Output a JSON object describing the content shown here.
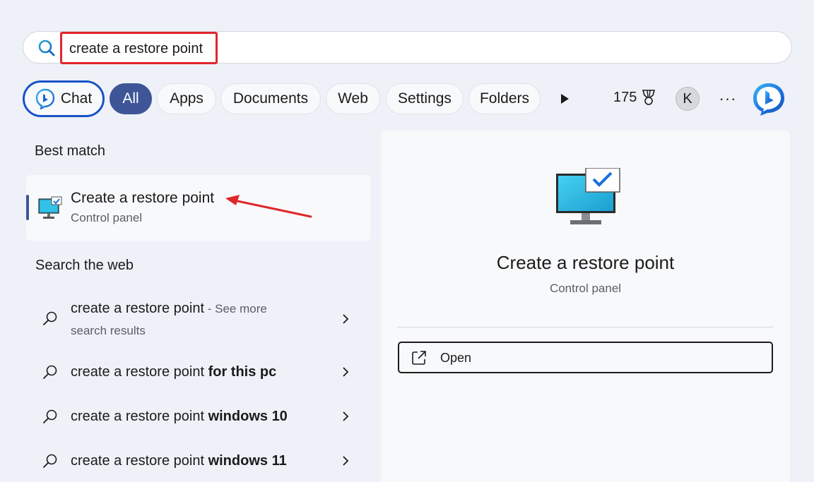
{
  "search": {
    "value": "create a restore point"
  },
  "filters": {
    "chat": "Chat",
    "all": "All",
    "apps": "Apps",
    "documents": "Documents",
    "web": "Web",
    "settings": "Settings",
    "folders": "Folders"
  },
  "rewards": {
    "points": "175"
  },
  "profile": {
    "initial": "K"
  },
  "more": {
    "label": "···"
  },
  "best_match": {
    "title": "Best match",
    "item": {
      "name": "Create a restore point",
      "subtitle": "Control panel"
    }
  },
  "search_web": {
    "title": "Search the web",
    "results": [
      {
        "query": "create a restore point",
        "suffix": " - See more",
        "suffix2": "search results"
      },
      {
        "query": "create a restore point ",
        "bold": "for this pc"
      },
      {
        "query": "create a restore point ",
        "bold": "windows 10"
      },
      {
        "query": "create a restore point ",
        "bold": "windows 11"
      }
    ]
  },
  "detail": {
    "title": "Create a restore point",
    "subtitle": "Control panel",
    "open_label": "Open"
  },
  "colors": {
    "accent": "#3e5598",
    "chat_border": "#1a52c9",
    "annotation_red": "#e0262b",
    "background": "#eef1f7"
  }
}
